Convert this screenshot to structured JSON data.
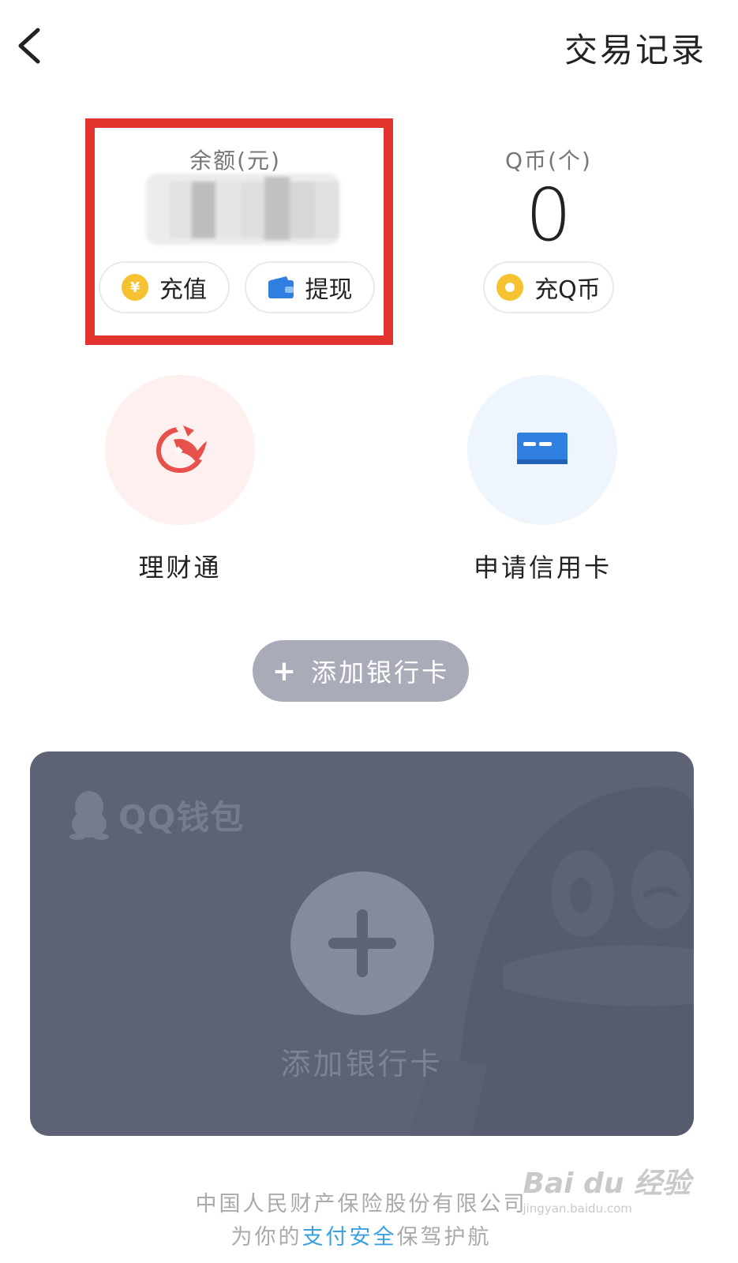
{
  "header": {
    "back_icon": "chevron-left-icon",
    "transaction_record": "交易记录"
  },
  "balance": {
    "label": "余额(元)",
    "value_obscured": true,
    "recharge_label": "充值",
    "withdraw_label": "提现"
  },
  "qcoin": {
    "label": "Q币(个)",
    "value": "0",
    "recharge_label": "充Q币"
  },
  "services": [
    {
      "label": "理财通",
      "icon": "koi-fish-icon"
    },
    {
      "label": "申请信用卡",
      "icon": "credit-card-icon"
    }
  ],
  "add_bank_card": {
    "label": "添加银行卡"
  },
  "card": {
    "brand": "QQ钱包",
    "add_label": "添加银行卡"
  },
  "footer": {
    "line1": "中国人民财产保险股份有限公司",
    "line2_prefix": "为你的",
    "line2_link": "支付安全",
    "line2_suffix": "保驾护航"
  },
  "watermark": {
    "main": "Bai du 经验",
    "sub": "jingyan.baidu.com"
  },
  "colors": {
    "highlight": "#e2332f",
    "coin": "#f6c232",
    "wallet_blue": "#2f7fe0",
    "fish_red": "#e8514b",
    "card_bg": "#5d6275",
    "link": "#3aa0e0"
  }
}
